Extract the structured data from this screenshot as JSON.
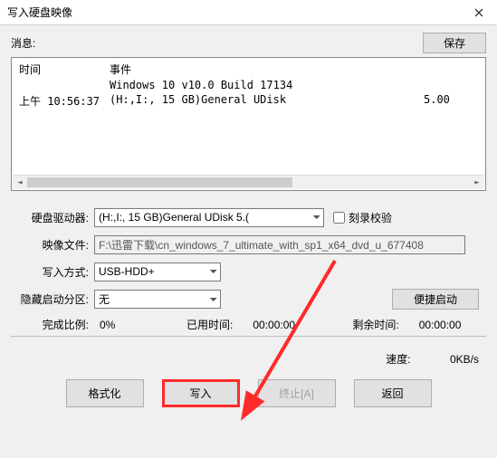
{
  "window": {
    "title": "写入硬盘映像"
  },
  "message": {
    "label": "消息:",
    "save_btn": "保存"
  },
  "log": {
    "col_time": "时间",
    "col_event": "事件",
    "rows": [
      {
        "time": "",
        "event": "Windows 10 v10.0 Build 17134",
        "extra": ""
      },
      {
        "time": "上午 10:56:37",
        "event": "(H:,I:, 15 GB)General UDisk",
        "extra": "5.00"
      }
    ]
  },
  "form": {
    "drive_label": "硬盘驱动器:",
    "drive_value": "(H:,I:, 15 GB)General UDisk            5.( ",
    "verify_label": "刻录校验",
    "image_label": "映像文件:",
    "image_value": "F:\\迅雷下载\\cn_windows_7_ultimate_with_sp1_x64_dvd_u_677408",
    "method_label": "写入方式:",
    "method_value": "USB-HDD+",
    "hidden_label": "隐藏启动分区:",
    "hidden_value": "无",
    "boot_btn": "便捷启动"
  },
  "progress": {
    "percent_label": "完成比例:",
    "percent_value": "0%",
    "elapsed_label": "已用时间:",
    "elapsed_value": "00:00:00",
    "remain_label": "剩余时间:",
    "remain_value": "00:00:00",
    "speed_label": "速度:",
    "speed_value": "0KB/s"
  },
  "actions": {
    "format": "格式化",
    "write": "写入",
    "abort": "终止[A]",
    "back": "返回"
  },
  "annotation": {
    "highlight_target": "write",
    "arrow_color": "#ff2a2a"
  }
}
